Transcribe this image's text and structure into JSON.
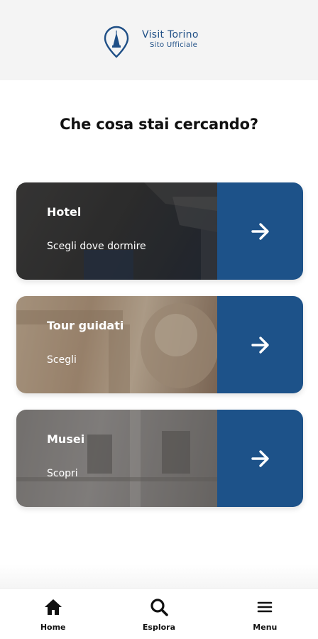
{
  "header": {
    "logo_title": "Visit Torino",
    "logo_subtitle": "Sito Ufficiale"
  },
  "page_title": "Che cosa stai cercando?",
  "cards": [
    {
      "title": "Hotel",
      "subtitle": "Scegli dove dormire",
      "action_icon": "arrow-right-icon"
    },
    {
      "title": "Tour guidati",
      "subtitle": "Scegli",
      "action_icon": "arrow-right-icon"
    },
    {
      "title": "Musei",
      "subtitle": "Scopri",
      "action_icon": "arrow-right-icon"
    }
  ],
  "bottom_nav": [
    {
      "label": "Home",
      "icon": "home-icon"
    },
    {
      "label": "Esplora",
      "icon": "search-icon"
    },
    {
      "label": "Menu",
      "icon": "menu-icon"
    }
  ],
  "colors": {
    "brand_blue": "#1d5289",
    "logo_blue": "#1f4f86",
    "header_bg": "#f4f4f4"
  }
}
